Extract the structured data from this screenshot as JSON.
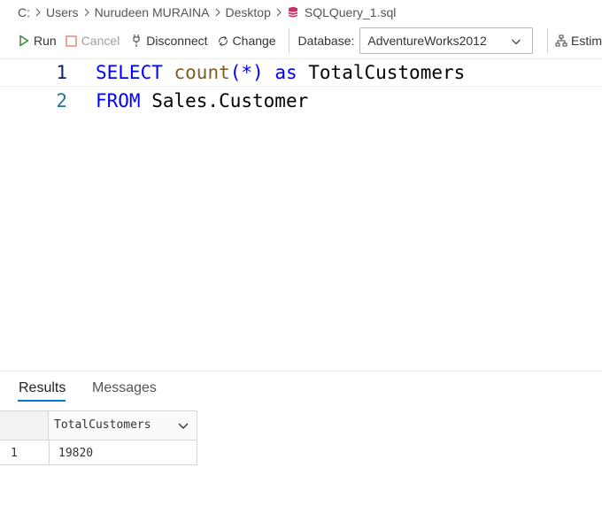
{
  "breadcrumb": {
    "items": [
      "C:",
      "Users",
      "Nurudeen MURAINA",
      "Desktop",
      "SQLQuery_1.sql"
    ],
    "separator": ">"
  },
  "toolbar": {
    "run_label": "Run",
    "cancel_label": "Cancel",
    "disconnect_label": "Disconnect",
    "change_label": "Change",
    "database_label": "Database:",
    "database_value": "AdventureWorks2012",
    "estimate_label": "Estim"
  },
  "editor": {
    "lines": [
      {
        "number": "1",
        "tokens": [
          {
            "text": "SELECT",
            "kind": "keyword"
          },
          {
            "text": " ",
            "kind": "plain"
          },
          {
            "text": "count",
            "kind": "function"
          },
          {
            "text": "(*)",
            "kind": "keyword"
          },
          {
            "text": " ",
            "kind": "plain"
          },
          {
            "text": "as",
            "kind": "keyword"
          },
          {
            "text": " TotalCustomers",
            "kind": "plain"
          }
        ]
      },
      {
        "number": "2",
        "tokens": [
          {
            "text": "FROM",
            "kind": "keyword"
          },
          {
            "text": " Sales.Customer",
            "kind": "plain"
          }
        ]
      }
    ]
  },
  "results": {
    "tabs": [
      "Results",
      "Messages"
    ],
    "active_tab": "Results",
    "columns": [
      "TotalCustomers"
    ],
    "rows": [
      {
        "row_number": "1",
        "values": [
          "19820"
        ]
      }
    ]
  },
  "colors": {
    "keyword": "#0000ff",
    "function": "#795e26",
    "line_number": "#237893",
    "accent": "#0078d4",
    "run_green": "#388a34",
    "cancel_red": "#e51400",
    "db_icon": "#c5326b"
  },
  "icons": {
    "run": "play-icon",
    "cancel": "stop-icon",
    "disconnect": "disconnect-plug-icon",
    "change": "change-connection-icon",
    "file": "database-file-icon",
    "estimate": "plan-tree-icon",
    "dropdown": "chevron-down-icon"
  }
}
